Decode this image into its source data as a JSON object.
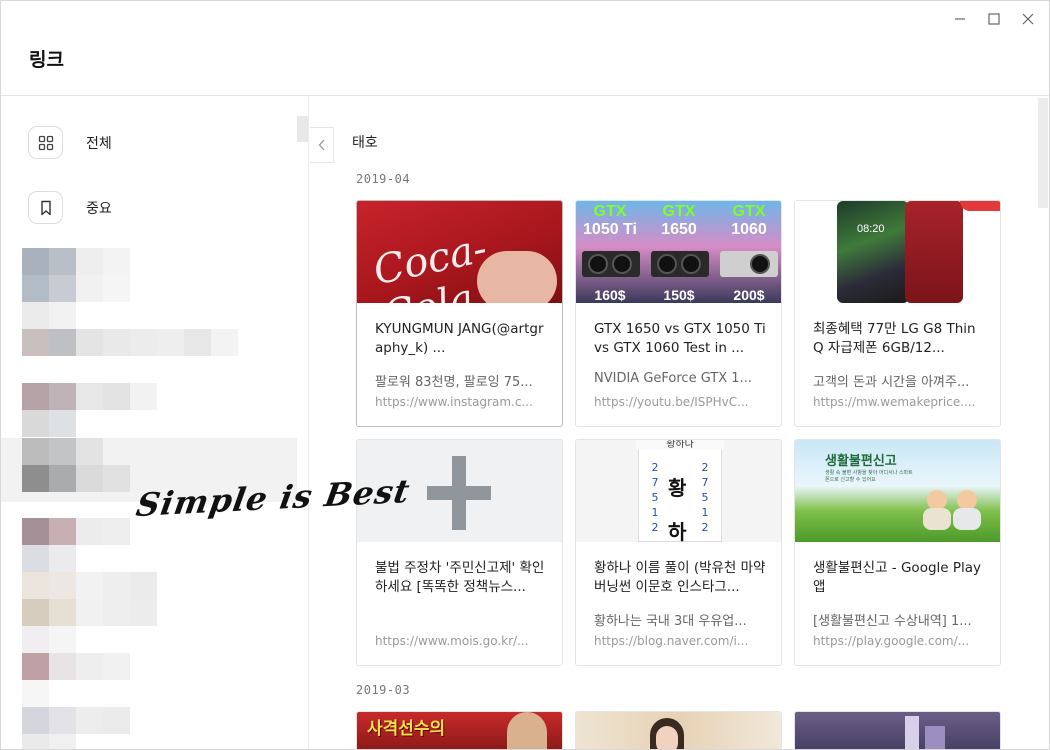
{
  "window": {
    "title": "링크",
    "controls": [
      "minimize-icon",
      "maximize-icon",
      "close-icon"
    ]
  },
  "sidebar": {
    "items": [
      {
        "label": "전체",
        "icon": "grid-icon"
      },
      {
        "label": "중요",
        "icon": "bookmark-icon"
      }
    ]
  },
  "overlay": {
    "signature": "Simple is Best"
  },
  "main": {
    "folder_title": "태호",
    "sections": [
      {
        "date": "2019-04",
        "cards": [
          {
            "title": "KYUNGMUN JANG(@artgraphy_k) ...",
            "desc": "팔로워 83천명, 팔로잉 75...",
            "url": "https://www.instagram.c..."
          },
          {
            "title": "GTX 1650 vs GTX 1050 Ti vs GTX 1060 Test in ...",
            "desc": "NVIDIA GeForce GTX 1...",
            "url": "https://youtu.be/ISPHvC..."
          },
          {
            "title": "최종혜택 77만 LG G8 ThinQ 자급제폰 6GB/12...",
            "desc": "고객의 돈과 시간을 아껴주...",
            "url": "https://mw.wemakeprice...."
          },
          {
            "title": "불법 주정차 '주민신고제' 확인하세요 [똑똑한 정책뉴스...",
            "desc": "",
            "url": "https://www.mois.go.kr/..."
          },
          {
            "title": "황하나 이름 풀이 (박유천 마약 버닝썬 이문호 인스타그...",
            "desc": "황하나는 국내 3대 우유업...",
            "url": "https://blog.naver.com/i..."
          },
          {
            "title": "생활불편신고 - Google Play 앱",
            "desc": "[생활불편신고 수상내역] 1...",
            "url": "https://play.google.com/..."
          }
        ]
      },
      {
        "date": "2019-03",
        "cards": []
      }
    ]
  },
  "thumbnails": {
    "coke_text": "Coca-Cola",
    "gtx": [
      {
        "brand": "GTX",
        "model": "1050 Ti",
        "price": "160$"
      },
      {
        "brand": "GTX",
        "model": "1650",
        "price": "150$"
      },
      {
        "brand": "GTX",
        "model": "1060",
        "price": "200$"
      }
    ],
    "phone_time": "08:20",
    "name_paper_head": "황하나",
    "name_big_1": "황",
    "name_big_2": "하",
    "name_col_left": "2 7 5 1 2",
    "name_col_right": "2 7 5 1 2",
    "report_title": "생활불편신고",
    "report_sub": "생활 속 불편 사항을 찾아 어디서나 스마트폰으로 신고할 수 있어요",
    "shoot_text": "사격선수의"
  }
}
